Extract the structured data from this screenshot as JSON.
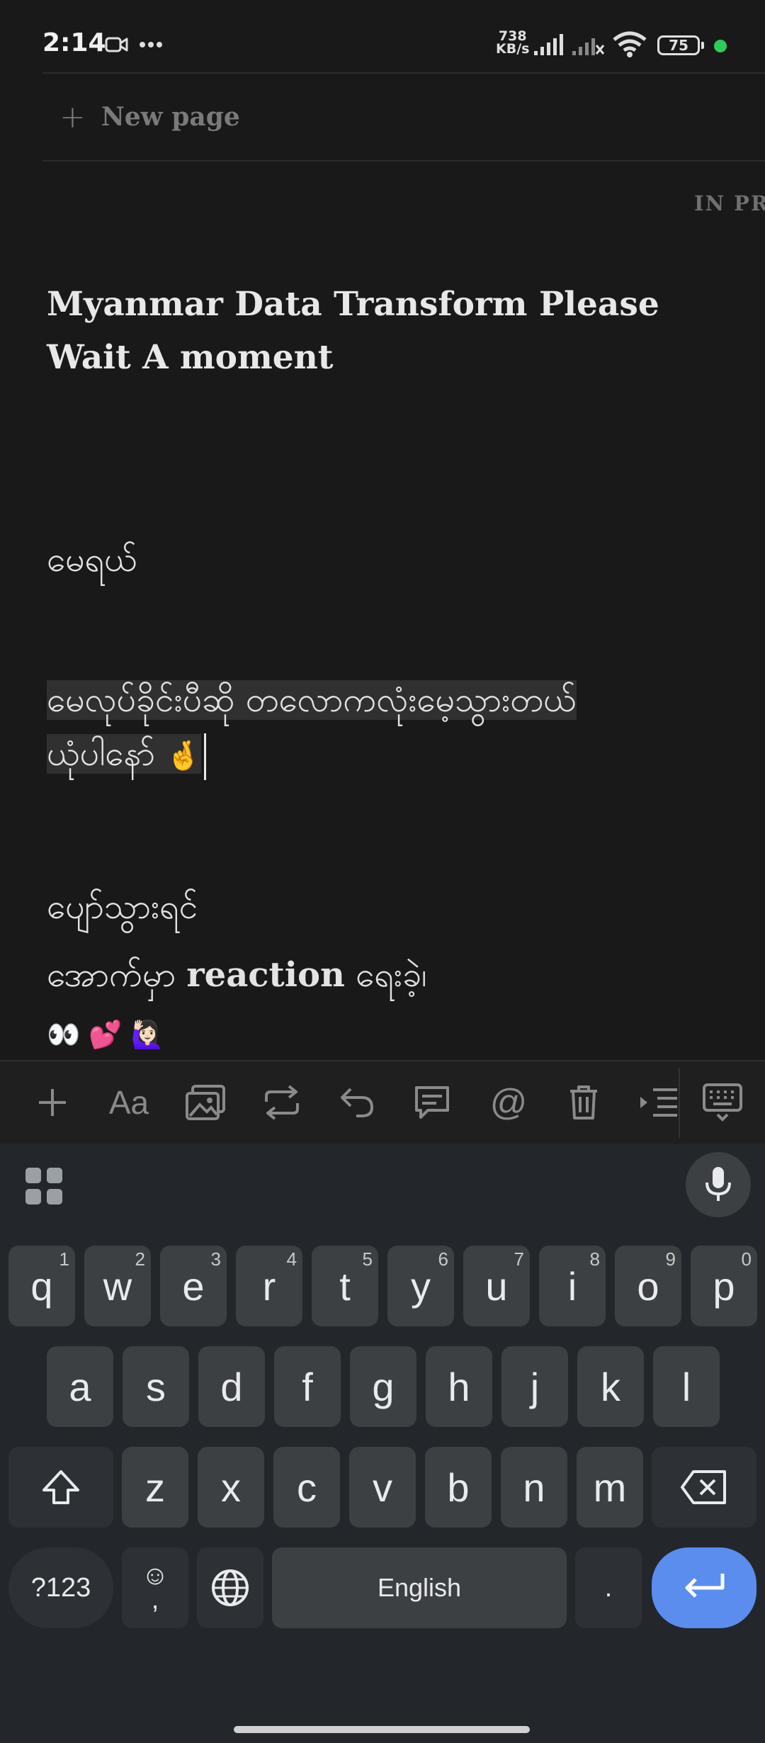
{
  "status_bar": {
    "time": "2:14",
    "net_speed_value": "738",
    "net_speed_unit": "KB/s",
    "battery": "75"
  },
  "sidebar": {
    "new_page_label": "New page"
  },
  "board": {
    "column_label": "IN PR"
  },
  "page": {
    "title": "Myanmar Data Transform Please Wait A moment",
    "line1": "မေရယ်",
    "line2": "မေလုပ်ခိုင်းပီဆို တလောကလုံးမေ့သွားတယ်",
    "line3": "ယုံပါနော်",
    "line3_emoji": "🤞",
    "line4": "ပျော်သွားရင်",
    "line5_prefix": "အောက်မှာ",
    "line5_bold": "reaction",
    "line5_suffix": "ရေးခဲ့၊",
    "line6_emoji": "👀 💕 🙋🏻‍♀️"
  },
  "keyboard": {
    "row1": [
      {
        "k": "q",
        "h": "1"
      },
      {
        "k": "w",
        "h": "2"
      },
      {
        "k": "e",
        "h": "3"
      },
      {
        "k": "r",
        "h": "4"
      },
      {
        "k": "t",
        "h": "5"
      },
      {
        "k": "y",
        "h": "6"
      },
      {
        "k": "u",
        "h": "7"
      },
      {
        "k": "i",
        "h": "8"
      },
      {
        "k": "o",
        "h": "9"
      },
      {
        "k": "p",
        "h": "0"
      }
    ],
    "row2": [
      "a",
      "s",
      "d",
      "f",
      "g",
      "h",
      "j",
      "k",
      "l"
    ],
    "row3": [
      "z",
      "x",
      "c",
      "v",
      "b",
      "n",
      "m"
    ],
    "symbols_label": "?123",
    "emoji_label": "☺",
    "comma_label": ",",
    "space_label": "English",
    "period_label": "."
  },
  "colors": {
    "enter_key": "#5b8def",
    "status_dot": "#2ecc59"
  }
}
